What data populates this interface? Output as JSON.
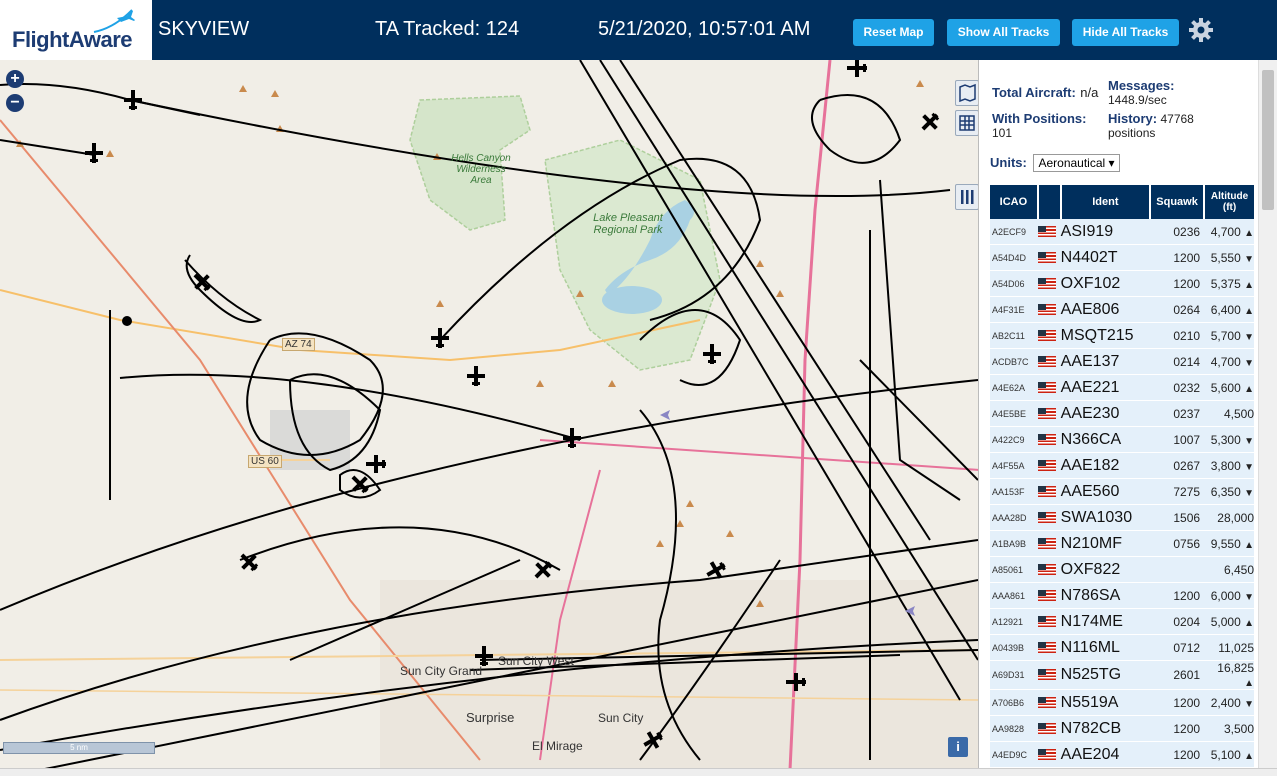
{
  "header": {
    "logo_text": "FlightAware",
    "app_title": "SKYVIEW",
    "tracked": "TA Tracked: 124",
    "datetime": "5/21/2020, 10:57:01 AM",
    "buttons": [
      "Reset Map",
      "Show All Tracks",
      "Hide All Tracks"
    ],
    "gear_icon": "gear-icon"
  },
  "map": {
    "zoom_in": "+",
    "zoom_out": "−",
    "labels": {
      "hells_canyon": "Hells Canyon Wilderness Area",
      "lake_pleasant": "Lake Pleasant Regional Park",
      "sun_city_grand": "Sun City Grand",
      "sun_city_west": "Sun City West",
      "surprise": "Surprise",
      "sun_city": "Sun City",
      "el_mirage": "El Mirage",
      "az74": "AZ 74",
      "us60": "US 60"
    },
    "scale": "5 nm",
    "info": "i"
  },
  "panel": {
    "total_aircraft_label": "Total Aircraft:",
    "total_aircraft_value": "n/a",
    "messages_label": "Messages:",
    "messages_value": "1448.9/sec",
    "with_positions_label": "With Positions:",
    "with_positions_value": "101",
    "history_label": "History:",
    "history_value": "47768 positions",
    "units_label": "Units:",
    "units_value": "Aeronautical",
    "columns": [
      "ICAO",
      "",
      "Ident",
      "Squawk",
      "Altitude (ft)"
    ],
    "rows": [
      {
        "icao": "A2ECF9",
        "ident": "ASI919",
        "squawk": "0236",
        "alt": "4,700",
        "trend": "▲"
      },
      {
        "icao": "A54D4D",
        "ident": "N4402T",
        "squawk": "1200",
        "alt": "5,550",
        "trend": "▼"
      },
      {
        "icao": "A54D06",
        "ident": "OXF102",
        "squawk": "1200",
        "alt": "5,375",
        "trend": "▲"
      },
      {
        "icao": "A4F31E",
        "ident": "AAE806",
        "squawk": "0264",
        "alt": "6,400",
        "trend": "▲"
      },
      {
        "icao": "AB2C11",
        "ident": "MSQT215",
        "squawk": "0210",
        "alt": "5,700",
        "trend": "▼"
      },
      {
        "icao": "ACDB7C",
        "ident": "AAE137",
        "squawk": "0214",
        "alt": "4,700",
        "trend": "▼"
      },
      {
        "icao": "A4E62A",
        "ident": "AAE221",
        "squawk": "0232",
        "alt": "5,600",
        "trend": "▲"
      },
      {
        "icao": "A4E5BE",
        "ident": "AAE230",
        "squawk": "0237",
        "alt": "4,500",
        "trend": ""
      },
      {
        "icao": "A422C9",
        "ident": "N366CA",
        "squawk": "1007",
        "alt": "5,300",
        "trend": "▼"
      },
      {
        "icao": "A4F55A",
        "ident": "AAE182",
        "squawk": "0267",
        "alt": "3,800",
        "trend": "▼"
      },
      {
        "icao": "AA153F",
        "ident": "AAE560",
        "squawk": "7275",
        "alt": "6,350",
        "trend": "▼"
      },
      {
        "icao": "AAA28D",
        "ident": "SWA1030",
        "squawk": "1506",
        "alt": "28,000",
        "trend": ""
      },
      {
        "icao": "A1BA9B",
        "ident": "N210MF",
        "squawk": "0756",
        "alt": "9,550",
        "trend": "▲"
      },
      {
        "icao": "A85061",
        "ident": "OXF822",
        "squawk": "",
        "alt": "6,450",
        "trend": ""
      },
      {
        "icao": "AAA861",
        "ident": "N786SA",
        "squawk": "1200",
        "alt": "6,000",
        "trend": "▼"
      },
      {
        "icao": "A12921",
        "ident": "N174ME",
        "squawk": "0204",
        "alt": "5,000",
        "trend": "▲"
      },
      {
        "icao": "A0439B",
        "ident": "N116ML",
        "squawk": "0712",
        "alt": "11,025",
        "trend": ""
      },
      {
        "icao": "A69D31",
        "ident": "N525TG",
        "squawk": "2601",
        "alt": "16,825",
        "trend": "▲"
      },
      {
        "icao": "A706B6",
        "ident": "N5519A",
        "squawk": "1200",
        "alt": "2,400",
        "trend": "▼"
      },
      {
        "icao": "AA9828",
        "ident": "N782CB",
        "squawk": "1200",
        "alt": "3,500",
        "trend": ""
      },
      {
        "icao": "A4ED9C",
        "ident": "AAE204",
        "squawk": "1200",
        "alt": "5,100",
        "trend": "▲"
      }
    ]
  }
}
